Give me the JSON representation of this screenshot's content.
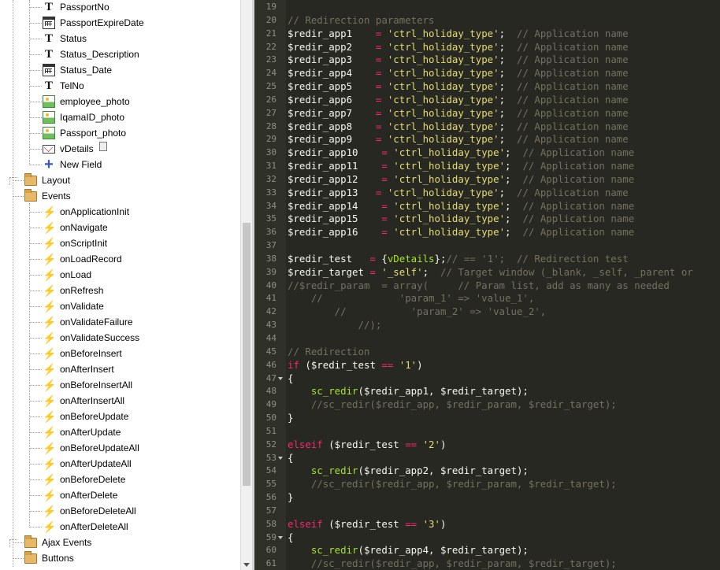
{
  "tree": {
    "rows": [
      {
        "label": "PassportNo",
        "icon": "text-field-icon",
        "indent": 2
      },
      {
        "label": "PassportExpireDate",
        "icon": "calendar-icon",
        "indent": 2
      },
      {
        "label": "Status",
        "icon": "text-field-icon",
        "indent": 2
      },
      {
        "label": "Status_Description",
        "icon": "text-field-icon",
        "indent": 2
      },
      {
        "label": "Status_Date",
        "icon": "calendar-icon",
        "indent": 2
      },
      {
        "label": "TelNo",
        "icon": "text-field-icon",
        "indent": 2
      },
      {
        "label": "employee_photo",
        "icon": "image-icon",
        "indent": 2
      },
      {
        "label": "IqamaID_photo",
        "icon": "image-icon",
        "indent": 2
      },
      {
        "label": "Passport_photo",
        "icon": "image-icon",
        "indent": 2
      },
      {
        "label": "vDetails",
        "icon": "email-field-icon",
        "indent": 2,
        "trash": true
      },
      {
        "label": "New Field",
        "icon": "add-field-icon",
        "indent": 2
      },
      {
        "label": "Layout",
        "icon": "folder-icon",
        "indent": 1,
        "expander": "plus"
      },
      {
        "label": "Events",
        "icon": "folder-icon",
        "indent": 1,
        "expander": "minus"
      },
      {
        "label": "onApplicationInit",
        "icon": "event-bolt-icon",
        "indent": 2
      },
      {
        "label": "onNavigate",
        "icon": "event-bolt-icon",
        "indent": 2
      },
      {
        "label": "onScriptInit",
        "icon": "event-bolt-icon",
        "indent": 2
      },
      {
        "label": "onLoadRecord",
        "icon": "event-bolt-icon",
        "indent": 2
      },
      {
        "label": "onLoad",
        "icon": "event-bolt-icon",
        "indent": 2
      },
      {
        "label": "onRefresh",
        "icon": "event-bolt-icon",
        "indent": 2
      },
      {
        "label": "onValidate",
        "icon": "event-bolt-icon",
        "indent": 2
      },
      {
        "label": "onValidateFailure",
        "icon": "event-bolt-icon",
        "indent": 2
      },
      {
        "label": "onValidateSuccess",
        "icon": "event-bolt-icon",
        "indent": 2
      },
      {
        "label": "onBeforeInsert",
        "icon": "event-bolt-icon",
        "indent": 2
      },
      {
        "label": "onAfterInsert",
        "icon": "event-bolt-icon",
        "indent": 2
      },
      {
        "label": "onBeforeInsertAll",
        "icon": "event-bolt-icon",
        "indent": 2
      },
      {
        "label": "onAfterInsertAll",
        "icon": "event-bolt-icon",
        "indent": 2
      },
      {
        "label": "onBeforeUpdate",
        "icon": "event-bolt-icon",
        "indent": 2
      },
      {
        "label": "onAfterUpdate",
        "icon": "event-bolt-active-icon",
        "indent": 2
      },
      {
        "label": "onBeforeUpdateAll",
        "icon": "event-bolt-icon",
        "indent": 2
      },
      {
        "label": "onAfterUpdateAll",
        "icon": "event-bolt-icon",
        "indent": 2
      },
      {
        "label": "onBeforeDelete",
        "icon": "event-bolt-icon",
        "indent": 2
      },
      {
        "label": "onAfterDelete",
        "icon": "event-bolt-icon",
        "indent": 2
      },
      {
        "label": "onBeforeDeleteAll",
        "icon": "event-bolt-icon",
        "indent": 2
      },
      {
        "label": "onAfterDeleteAll",
        "icon": "event-bolt-icon",
        "indent": 2
      },
      {
        "label": "Ajax Events",
        "icon": "folder-icon",
        "indent": 1,
        "expander": "plus"
      },
      {
        "label": "Buttons",
        "icon": "folder-icon",
        "indent": 1,
        "expander": "minus"
      }
    ]
  },
  "editor": {
    "theme_colors": {
      "background": "#272822",
      "comment": "#75715e",
      "string": "#e6db74",
      "keyword": "#f92672",
      "function": "#a6e22e",
      "text": "#f8f8f2"
    },
    "lines": [
      {
        "n": "19",
        "t": []
      },
      {
        "n": "20",
        "t": [
          [
            "c",
            "// Redirection parameters"
          ]
        ]
      },
      {
        "n": "21",
        "t": [
          [
            "v",
            "$redir_app1    "
          ],
          [
            "o",
            "="
          ],
          [
            "p",
            " "
          ],
          [
            "s",
            "'ctrl_holiday_type'"
          ],
          [
            "p",
            ";  "
          ],
          [
            "c",
            "// Application name"
          ]
        ]
      },
      {
        "n": "22",
        "t": [
          [
            "v",
            "$redir_app2    "
          ],
          [
            "o",
            "="
          ],
          [
            "p",
            " "
          ],
          [
            "s",
            "'ctrl_holiday_type'"
          ],
          [
            "p",
            ";  "
          ],
          [
            "c",
            "// Application name"
          ]
        ]
      },
      {
        "n": "23",
        "t": [
          [
            "v",
            "$redir_app3    "
          ],
          [
            "o",
            "="
          ],
          [
            "p",
            " "
          ],
          [
            "s",
            "'ctrl_holiday_type'"
          ],
          [
            "p",
            ";  "
          ],
          [
            "c",
            "// Application name"
          ]
        ]
      },
      {
        "n": "24",
        "t": [
          [
            "v",
            "$redir_app4    "
          ],
          [
            "o",
            "="
          ],
          [
            "p",
            " "
          ],
          [
            "s",
            "'ctrl_holiday_type'"
          ],
          [
            "p",
            ";  "
          ],
          [
            "c",
            "// Application name"
          ]
        ]
      },
      {
        "n": "25",
        "t": [
          [
            "v",
            "$redir_app5    "
          ],
          [
            "o",
            "="
          ],
          [
            "p",
            " "
          ],
          [
            "s",
            "'ctrl_holiday_type'"
          ],
          [
            "p",
            ";  "
          ],
          [
            "c",
            "// Application name"
          ]
        ]
      },
      {
        "n": "26",
        "t": [
          [
            "v",
            "$redir_app6    "
          ],
          [
            "o",
            "="
          ],
          [
            "p",
            " "
          ],
          [
            "s",
            "'ctrl_holiday_type'"
          ],
          [
            "p",
            ";  "
          ],
          [
            "c",
            "// Application name"
          ]
        ]
      },
      {
        "n": "27",
        "t": [
          [
            "v",
            "$redir_app7    "
          ],
          [
            "o",
            "="
          ],
          [
            "p",
            " "
          ],
          [
            "s",
            "'ctrl_holiday_type'"
          ],
          [
            "p",
            ";  "
          ],
          [
            "c",
            "// Application name"
          ]
        ]
      },
      {
        "n": "28",
        "t": [
          [
            "v",
            "$redir_app8    "
          ],
          [
            "o",
            "="
          ],
          [
            "p",
            " "
          ],
          [
            "s",
            "'ctrl_holiday_type'"
          ],
          [
            "p",
            ";  "
          ],
          [
            "c",
            "// Application name"
          ]
        ]
      },
      {
        "n": "29",
        "t": [
          [
            "v",
            "$redir_app9    "
          ],
          [
            "o",
            "="
          ],
          [
            "p",
            " "
          ],
          [
            "s",
            "'ctrl_holiday_type'"
          ],
          [
            "p",
            ";  "
          ],
          [
            "c",
            "// Application name"
          ]
        ]
      },
      {
        "n": "30",
        "t": [
          [
            "v",
            "$redir_app10    "
          ],
          [
            "o",
            "="
          ],
          [
            "p",
            " "
          ],
          [
            "s",
            "'ctrl_holiday_type'"
          ],
          [
            "p",
            ";  "
          ],
          [
            "c",
            "// Application name"
          ]
        ]
      },
      {
        "n": "31",
        "t": [
          [
            "v",
            "$redir_app11    "
          ],
          [
            "o",
            "="
          ],
          [
            "p",
            " "
          ],
          [
            "s",
            "'ctrl_holiday_type'"
          ],
          [
            "p",
            ";  "
          ],
          [
            "c",
            "// Application name"
          ]
        ]
      },
      {
        "n": "32",
        "t": [
          [
            "v",
            "$redir_app12    "
          ],
          [
            "o",
            "="
          ],
          [
            "p",
            " "
          ],
          [
            "s",
            "'ctrl_holiday_type'"
          ],
          [
            "p",
            ";  "
          ],
          [
            "c",
            "// Application name"
          ]
        ]
      },
      {
        "n": "33",
        "t": [
          [
            "v",
            "$redir_app13   "
          ],
          [
            "o",
            "="
          ],
          [
            "p",
            " "
          ],
          [
            "s",
            "'ctrl_holiday_type'"
          ],
          [
            "p",
            ";  "
          ],
          [
            "c",
            "// Application name"
          ]
        ]
      },
      {
        "n": "34",
        "t": [
          [
            "v",
            "$redir_app14    "
          ],
          [
            "o",
            "="
          ],
          [
            "p",
            " "
          ],
          [
            "s",
            "'ctrl_holiday_type'"
          ],
          [
            "p",
            ";  "
          ],
          [
            "c",
            "// Application name"
          ]
        ]
      },
      {
        "n": "35",
        "t": [
          [
            "v",
            "$redir_app15    "
          ],
          [
            "o",
            "="
          ],
          [
            "p",
            " "
          ],
          [
            "s",
            "'ctrl_holiday_type'"
          ],
          [
            "p",
            ";  "
          ],
          [
            "c",
            "// Application name"
          ]
        ]
      },
      {
        "n": "36",
        "t": [
          [
            "v",
            "$redir_app16    "
          ],
          [
            "o",
            "="
          ],
          [
            "p",
            " "
          ],
          [
            "s",
            "'ctrl_holiday_type'"
          ],
          [
            "p",
            ";  "
          ],
          [
            "c",
            "// Application name"
          ]
        ]
      },
      {
        "n": "37",
        "t": []
      },
      {
        "n": "38",
        "t": [
          [
            "v",
            "$redir_test   "
          ],
          [
            "o",
            "="
          ],
          [
            "p",
            " {"
          ],
          [
            "f",
            "vDetails"
          ],
          [
            "p",
            "};"
          ],
          [
            "c",
            "// == '1';  // Redirection test"
          ]
        ]
      },
      {
        "n": "39",
        "t": [
          [
            "v",
            "$redir_target "
          ],
          [
            "o",
            "="
          ],
          [
            "p",
            " "
          ],
          [
            "s",
            "'_self'"
          ],
          [
            "p",
            ";  "
          ],
          [
            "c",
            "// Target window (_blank, _self, _parent or"
          ]
        ]
      },
      {
        "n": "40",
        "t": [
          [
            "c",
            "//$redir_param  = array(     // Param list, add as many as needed"
          ]
        ]
      },
      {
        "n": "41",
        "t": [
          [
            "c",
            "    //             'param_1' => 'value_1',"
          ]
        ]
      },
      {
        "n": "42",
        "t": [
          [
            "c",
            "        //           'param_2' => 'value_2',"
          ]
        ]
      },
      {
        "n": "43",
        "t": [
          [
            "c",
            "            //);"
          ]
        ]
      },
      {
        "n": "44",
        "t": []
      },
      {
        "n": "45",
        "t": [
          [
            "c",
            "// Redirection"
          ]
        ]
      },
      {
        "n": "46",
        "t": [
          [
            "k",
            "if"
          ],
          [
            "p",
            " ($redir_test "
          ],
          [
            "o",
            "=="
          ],
          [
            "p",
            " "
          ],
          [
            "s",
            "'1'"
          ],
          [
            "p",
            ")"
          ]
        ]
      },
      {
        "n": "47",
        "fold": true,
        "t": [
          [
            "p",
            "{"
          ]
        ]
      },
      {
        "n": "48",
        "t": [
          [
            "p",
            "    "
          ],
          [
            "f",
            "sc_redir"
          ],
          [
            "p",
            "($redir_app1, $redir_target);"
          ]
        ]
      },
      {
        "n": "49",
        "t": [
          [
            "c",
            "    //sc_redir($redir_app, $redir_param, $redir_target);"
          ]
        ]
      },
      {
        "n": "50",
        "t": [
          [
            "p",
            "}"
          ]
        ]
      },
      {
        "n": "51",
        "t": []
      },
      {
        "n": "52",
        "t": [
          [
            "k",
            "elseif"
          ],
          [
            "p",
            " ($redir_test "
          ],
          [
            "o",
            "=="
          ],
          [
            "p",
            " "
          ],
          [
            "s",
            "'2'"
          ],
          [
            "p",
            ")"
          ]
        ]
      },
      {
        "n": "53",
        "fold": true,
        "t": [
          [
            "p",
            "{"
          ]
        ]
      },
      {
        "n": "54",
        "t": [
          [
            "p",
            "    "
          ],
          [
            "f",
            "sc_redir"
          ],
          [
            "p",
            "($redir_app2, $redir_target);"
          ]
        ]
      },
      {
        "n": "55",
        "t": [
          [
            "c",
            "    //sc_redir($redir_app, $redir_param, $redir_target);"
          ]
        ]
      },
      {
        "n": "56",
        "t": [
          [
            "p",
            "}"
          ]
        ]
      },
      {
        "n": "57",
        "t": []
      },
      {
        "n": "58",
        "t": [
          [
            "k",
            "elseif"
          ],
          [
            "p",
            " ($redir_test "
          ],
          [
            "o",
            "=="
          ],
          [
            "p",
            " "
          ],
          [
            "s",
            "'3'"
          ],
          [
            "p",
            ")"
          ]
        ]
      },
      {
        "n": "59",
        "fold": true,
        "t": [
          [
            "p",
            "{"
          ]
        ]
      },
      {
        "n": "60",
        "t": [
          [
            "p",
            "    "
          ],
          [
            "f",
            "sc_redir"
          ],
          [
            "p",
            "($redir_app4, $redir_target);"
          ]
        ]
      },
      {
        "n": "61",
        "t": [
          [
            "c",
            "    //sc_redir($redir_app, $redir_param, $redir_target);"
          ]
        ]
      }
    ]
  }
}
